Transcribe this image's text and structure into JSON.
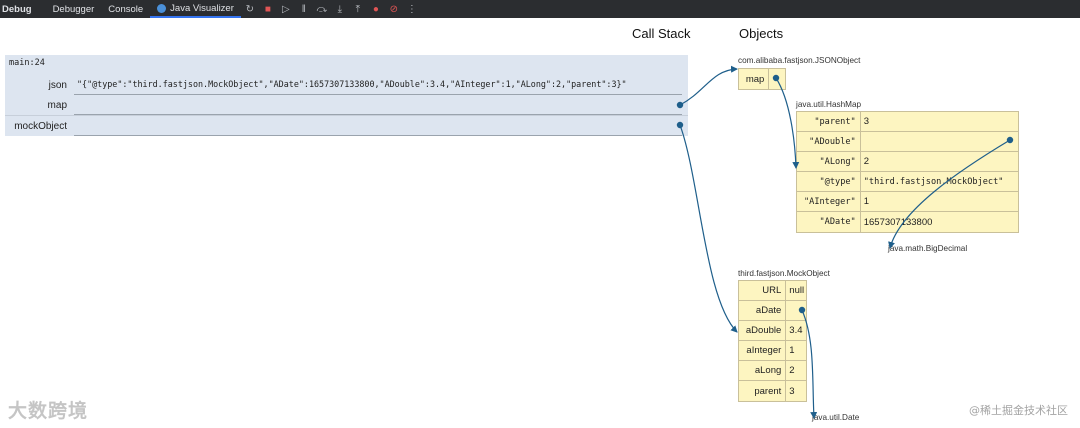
{
  "toolbar": {
    "title": "Debug",
    "tabs": [
      {
        "label": "Debugger",
        "active": false
      },
      {
        "label": "Console",
        "active": false
      },
      {
        "label": "Java Visualizer",
        "active": true
      }
    ],
    "icons": [
      "rerun-icon",
      "stop-icon",
      "resume-icon",
      "pause-icon",
      "step-over-icon",
      "step-into-icon",
      "step-out-icon",
      "view-breakpoints-icon",
      "mute-breakpoints-icon",
      "more-icon"
    ]
  },
  "headers": {
    "call_stack": "Call Stack",
    "objects": "Objects"
  },
  "frame": {
    "title": "main:24",
    "vars": [
      {
        "name": "json",
        "value": "\"{\"@type\":\"third.fastjson.MockObject\",\"ADate\":1657307133800,\"ADouble\":3.4,\"AInteger\":1,\"ALong\":2,\"parent\":3}\""
      },
      {
        "name": "map",
        "value": ""
      },
      {
        "name": "mockObject",
        "value": ""
      }
    ]
  },
  "json_object": {
    "type": "com.alibaba.fastjson.JSONObject",
    "fields": [
      {
        "key": "map",
        "value": ""
      }
    ]
  },
  "hashmap": {
    "type": "java.util.HashMap",
    "entries": [
      {
        "key": "\"parent\"",
        "value": "3"
      },
      {
        "key": "\"ADouble\"",
        "value": ""
      },
      {
        "key": "\"ALong\"",
        "value": "2"
      },
      {
        "key": "\"@type\"",
        "value": "\"third.fastjson.MockObject\""
      },
      {
        "key": "\"AInteger\"",
        "value": "1"
      },
      {
        "key": "\"ADate\"",
        "value": "1657307133800"
      }
    ]
  },
  "big_decimal": {
    "type": "java.math.BigDecimal"
  },
  "mock_object": {
    "type": "third.fastjson.MockObject",
    "fields": [
      {
        "key": "URL",
        "value": "null"
      },
      {
        "key": "aDate",
        "value": ""
      },
      {
        "key": "aDouble",
        "value": "3.4"
      },
      {
        "key": "aInteger",
        "value": "1"
      },
      {
        "key": "aLong",
        "value": "2"
      },
      {
        "key": "parent",
        "value": "3"
      }
    ]
  },
  "date_object": {
    "type": "java.util.Date"
  },
  "watermarks": {
    "left": "大数跨境",
    "right": "@稀土掘金技术社区"
  },
  "colors": {
    "frame_bg": "#dde5f0",
    "object_bg": "#fdf5c1",
    "arrow": "#1f5f8b",
    "toolbar_bg": "#2b2d30"
  }
}
